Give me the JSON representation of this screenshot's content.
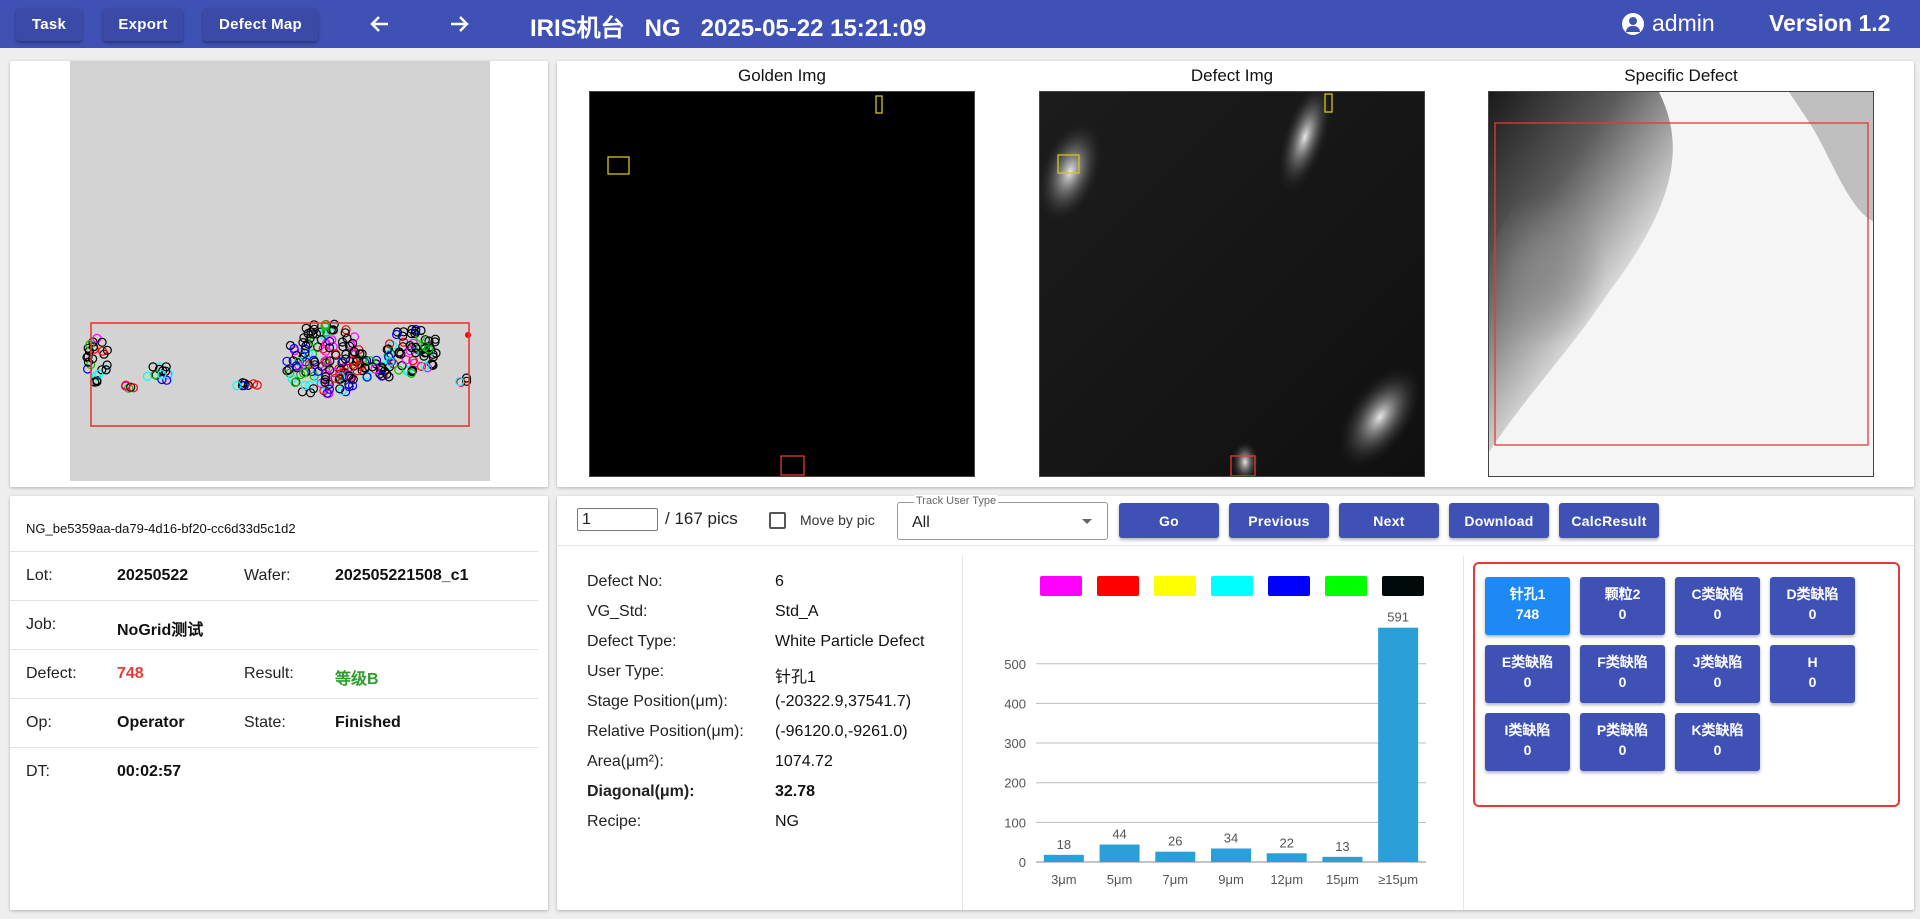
{
  "toolbar": {
    "task_label": "Task",
    "export_label": "Export",
    "defect_map_label": "Defect Map",
    "back_icon": "arrow-left-icon",
    "forward_icon": "arrow-right-icon",
    "title": "IRIS机台   NG   2025-05-22 15:21:09",
    "user": "admin",
    "version": "Version 1.2"
  },
  "images": {
    "golden_title": "Golden Img",
    "defect_title": "Defect Img",
    "specific_title": "Specific Defect"
  },
  "info": {
    "id": "NG_be5359aa-da79-4d16-bf20-cc6d33d5c1d2",
    "lot_label": "Lot:",
    "lot": "20250522",
    "wafer_label": "Wafer:",
    "wafer": "202505221508_c1",
    "job_label": "Job:",
    "job": "NoGrid测试",
    "defect_label": "Defect:",
    "defect": "748",
    "result_label": "Result:",
    "result": "等级B",
    "op_label": "Op:",
    "op": "Operator",
    "state_label": "State:",
    "state": "Finished",
    "dt_label": "DT:",
    "dt": "00:02:57"
  },
  "pager": {
    "current": "1",
    "total": "/ 167 pics",
    "move_by_pic": "Move by pic",
    "track_label": "Track User Type",
    "track_value": "All",
    "go": "Go",
    "previous": "Previous",
    "next": "Next",
    "download": "Download",
    "calc": "CalcResult"
  },
  "detail": {
    "defect_no_label": "Defect No:",
    "defect_no": "6",
    "vg_std_label": "VG_Std:",
    "vg_std": "Std_A",
    "defect_type_label": "Defect Type:",
    "defect_type": "White Particle Defect",
    "user_type_label": "User Type:",
    "user_type": "针孔1",
    "stage_pos_label": "Stage Position(μm):",
    "stage_pos": "(-20322.9,37541.7)",
    "rel_pos_label": "Relative Position(μm):",
    "rel_pos": "(-96120.0,-9261.0)",
    "area_label": "Area(μm²):",
    "area": "1074.72",
    "diagonal_label": "Diagonal(μm):",
    "diagonal": "32.78",
    "recipe_label": "Recipe:",
    "recipe": "NG"
  },
  "chart_data": {
    "type": "bar",
    "categories": [
      "3μm",
      "5μm",
      "7μm",
      "9μm",
      "12μm",
      "15μm",
      "≥15μm"
    ],
    "values": [
      18,
      44,
      26,
      34,
      22,
      13,
      591
    ],
    "yticks": [
      0,
      100,
      200,
      300,
      400,
      500
    ],
    "ylim": [
      0,
      600
    ],
    "bar_color": "#2a9fd8",
    "legend_colors": [
      "#ff00ff",
      "#ff0000",
      "#ffff00",
      "#00ffff",
      "#0000ff",
      "#00ff00",
      "#000a0a"
    ],
    "grid": true
  },
  "categories": [
    {
      "name": "针孔1",
      "count": "748",
      "active": true
    },
    {
      "name": "颗粒2",
      "count": "0"
    },
    {
      "name": "C类缺陷",
      "count": "0"
    },
    {
      "name": "D类缺陷",
      "count": "0"
    },
    {
      "name": "E类缺陷",
      "count": "0"
    },
    {
      "name": "F类缺陷",
      "count": "0"
    },
    {
      "name": "J类缺陷",
      "count": "0"
    },
    {
      "name": "H",
      "count": "0"
    },
    {
      "name": "I类缺陷",
      "count": "0"
    },
    {
      "name": "P类缺陷",
      "count": "0"
    },
    {
      "name": "K类缺陷",
      "count": "0"
    }
  ],
  "colors": {
    "header": "#3f51b5",
    "button": "#3f51b5",
    "active_category": "#1e88f5",
    "defect_count": "#e53935",
    "result": "#2e9d2e",
    "highlight": "#e53935"
  }
}
